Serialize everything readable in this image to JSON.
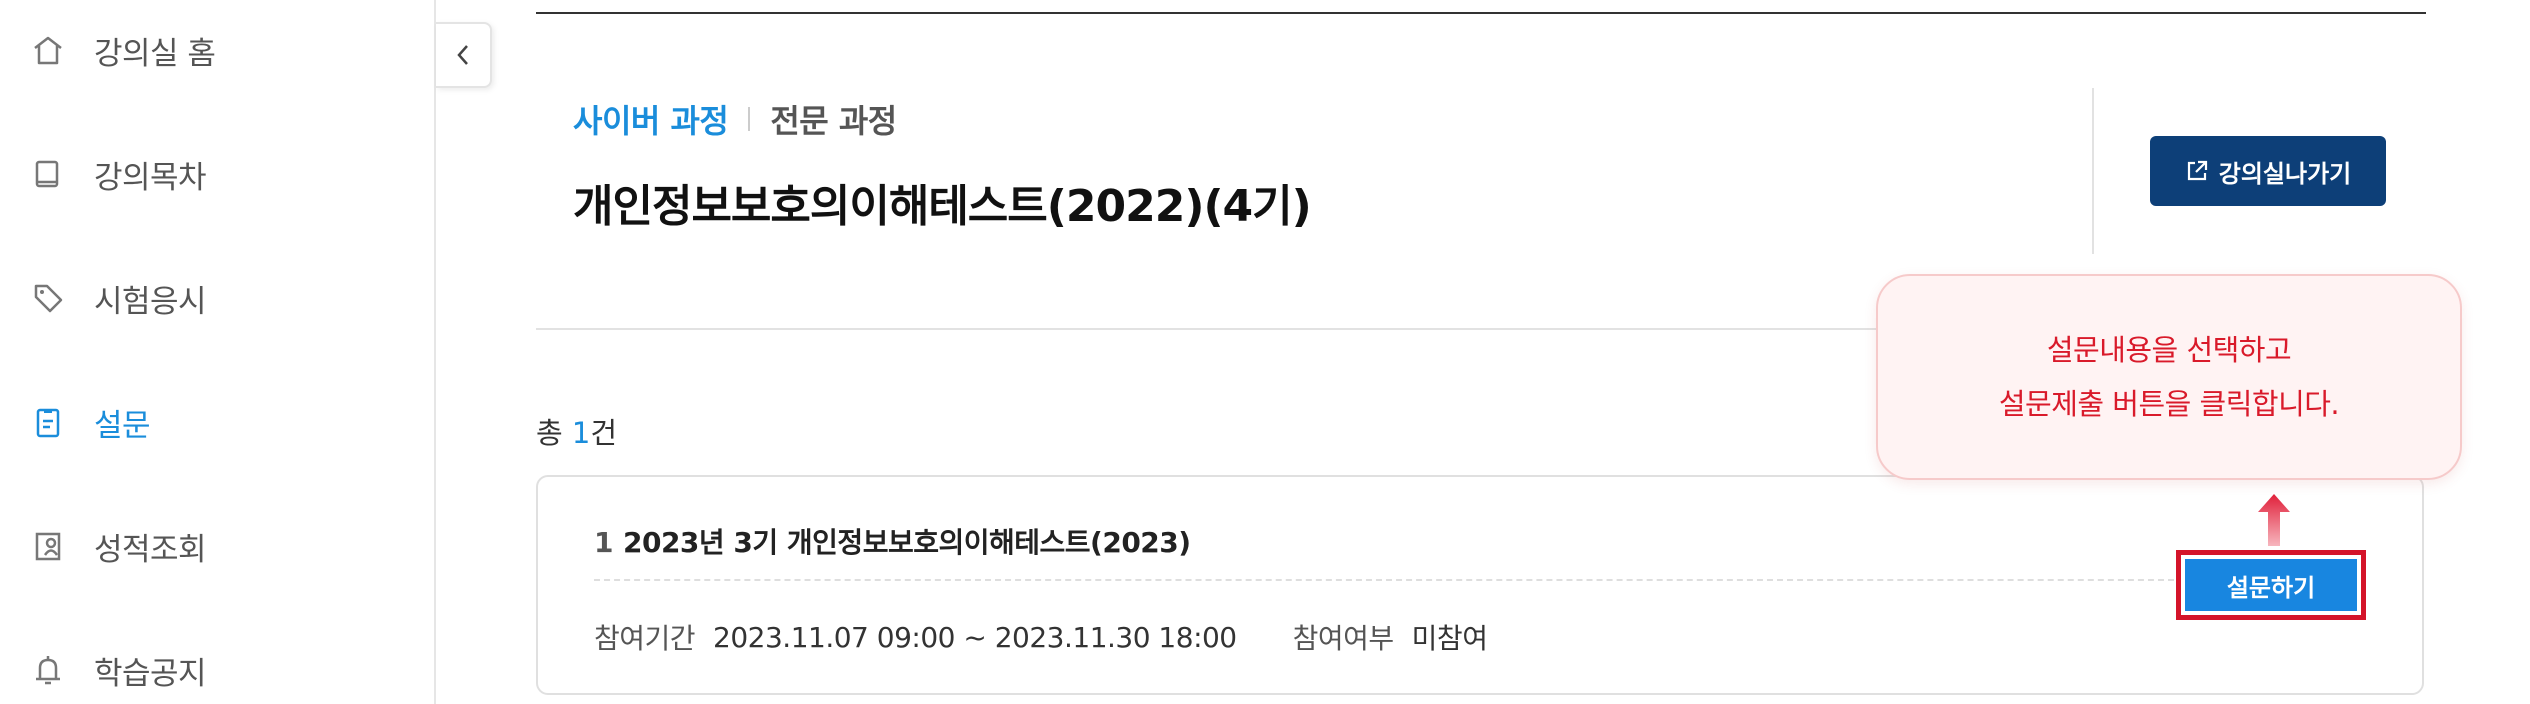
{
  "sidebar": {
    "items": [
      {
        "label": "강의실 홈",
        "icon": "home-icon"
      },
      {
        "label": "강의목차",
        "icon": "book-icon"
      },
      {
        "label": "시험응시",
        "icon": "tag-icon"
      },
      {
        "label": "설문",
        "icon": "clipboard-icon",
        "active": true
      },
      {
        "label": "성적조회",
        "icon": "grade-report-icon"
      },
      {
        "label": "학습공지",
        "icon": "bell-icon"
      }
    ]
  },
  "header": {
    "breadcrumb_active": "사이버 과정",
    "breadcrumb_second": "전문 과정",
    "course_title": "개인정보보호의이해테스트(2022)(4기)",
    "enter_button": "강의실나가기"
  },
  "list": {
    "total_prefix": "총 ",
    "total_count": "1",
    "total_suffix": "건",
    "items": [
      {
        "index": "1",
        "title": "2023년 3기 개인정보보호의이해테스트(2023)",
        "period_label": "참여기간",
        "period_value": "2023.11.07 09:00 ~ 2023.11.30 18:00",
        "status_label": "참여여부",
        "status_value": "미참여",
        "action_label": "설문하기"
      }
    ]
  },
  "tooltip": {
    "line1": "설문내용을 선택하고",
    "line2": "설문제출 버튼을 클릭합니다."
  },
  "colors": {
    "accent_blue": "#1a8ddb",
    "navy_button": "#0d3f78",
    "survey_button": "#1886e0",
    "highlight_red": "#d4142a"
  }
}
